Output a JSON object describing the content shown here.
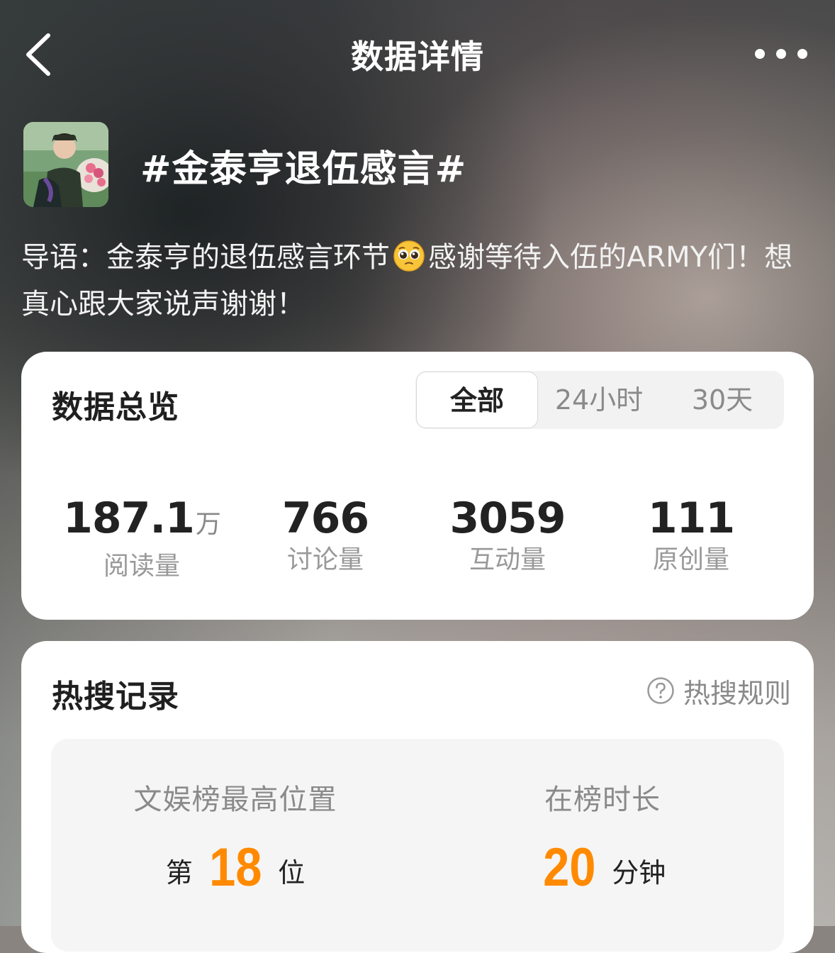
{
  "header": {
    "title": "数据详情"
  },
  "topic": {
    "title": "#金泰亨退伍感言#",
    "intro_before": "导语：金泰亨的退伍感言环节",
    "intro_after": "感谢等待入伍的ARMY们！想真心跟大家说声谢谢！"
  },
  "overview": {
    "title": "数据总览",
    "tabs": [
      "全部",
      "24小时",
      "30天"
    ],
    "active_tab": "全部",
    "stats": [
      {
        "value": "187.1",
        "unit": "万",
        "label": "阅读量"
      },
      {
        "value": "766",
        "unit": "",
        "label": "讨论量"
      },
      {
        "value": "3059",
        "unit": "",
        "label": "互动量"
      },
      {
        "value": "111",
        "unit": "",
        "label": "原创量"
      }
    ]
  },
  "hot_search": {
    "title": "热搜记录",
    "rules_label": "热搜规则",
    "peak": {
      "label": "文娱榜最高位置",
      "prefix": "第",
      "value": "18",
      "suffix": "位"
    },
    "duration": {
      "label": "在榜时长",
      "value": "20",
      "suffix": "分钟"
    }
  },
  "colors": {
    "accent": "#ff8a00"
  },
  "icons": {
    "back": "chevron-left-icon",
    "more": "more-horizontal-icon",
    "rules": "question-circle-icon",
    "emoji": "pleading-face-icon"
  }
}
